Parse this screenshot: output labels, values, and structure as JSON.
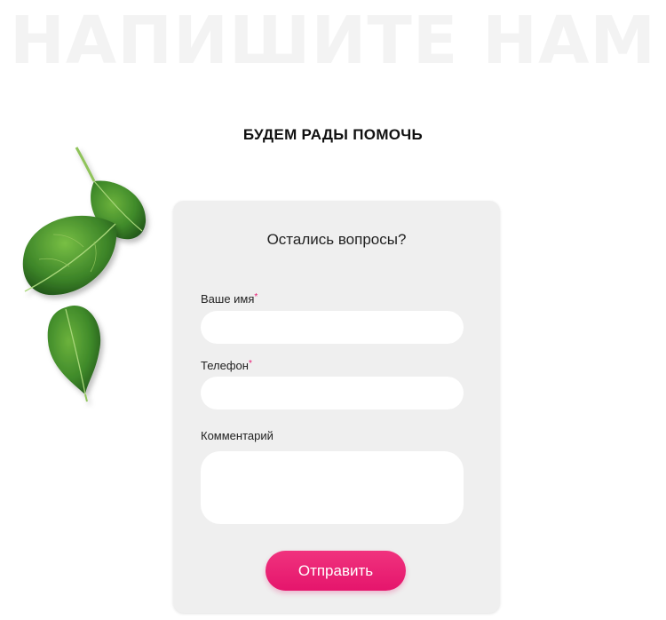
{
  "page": {
    "bg_title": "НАПИШИТЕ НАМ",
    "subtitle": "БУДЕМ РАДЫ ПОМОЧЬ"
  },
  "form": {
    "title": "Остались вопросы?",
    "name_label": "Ваше имя",
    "name_value": "",
    "phone_label": "Телефон",
    "phone_value": "",
    "comment_label": "Комментарий",
    "comment_value": "",
    "required_mark": "*",
    "submit_label": "Отправить"
  },
  "colors": {
    "accent": "#e8156f",
    "card_bg": "#efefef",
    "leaf": "#3f8a2a"
  },
  "decor": {
    "image": "spinach-leaves"
  }
}
